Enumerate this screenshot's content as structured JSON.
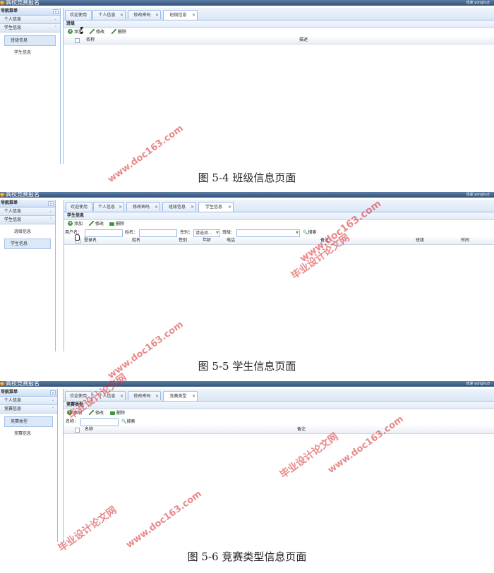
{
  "app": {
    "title": "高校竞赛报名",
    "nav_header": "导航菜单",
    "accordion_personal": "个人信息",
    "accordion_student": "学生信息",
    "accordion_competition": "竞赛信息"
  },
  "shot1": {
    "welcome": "欢迎 yonghu2",
    "nav_items": [
      "班级信息",
      "学生信息"
    ],
    "tabs": [
      "欢迎使用",
      "个人信息",
      "修改密码",
      "班级信息"
    ],
    "panel_title": "班级",
    "toolbar": {
      "add": "添加",
      "edit": "修改",
      "delete": "删除"
    },
    "columns": [
      "名称",
      "描述"
    ],
    "caption": "图 5-4 班级信息页面"
  },
  "shot2": {
    "welcome": "欢迎 yonghu2",
    "nav_items": [
      "班级信息",
      "学生信息"
    ],
    "tabs": [
      "欢迎使用",
      "个人信息",
      "修改密码",
      "班级信息",
      "学生信息"
    ],
    "panel_title": "学生信息",
    "toolbar": {
      "add": "添加",
      "edit": "修改",
      "delete": "删除"
    },
    "search": {
      "login_label": "用户名：",
      "name_label": "姓名：",
      "gender_label": "性别：",
      "gender_value": "请选择...",
      "class_label": "班级：",
      "search_button": "搜索"
    },
    "columns": [
      "登录名",
      "姓名",
      "性别",
      "年龄",
      "电话",
      "备注",
      "班级",
      "时间"
    ],
    "caption": "图 5-5 学生信息页面"
  },
  "shot3": {
    "welcome": "欢迎 yonghu3",
    "nav_items": [
      "竞赛类型",
      "竞赛信息"
    ],
    "tabs": [
      "欢迎使用",
      "个人信息",
      "修改密码",
      "竞赛类型"
    ],
    "panel_title": "竞赛类型",
    "toolbar": {
      "add": "添加",
      "edit": "修改",
      "delete": "删除"
    },
    "search": {
      "name_label": "名称：",
      "search_button": "搜索"
    },
    "columns": [
      "名称",
      "备注"
    ],
    "caption": "图 5-6 竞赛类型信息页面"
  },
  "watermarks": {
    "cn": "毕业设计论文网",
    "url": "www.doc163.com"
  },
  "colors": {
    "titlebar": "#3d6189",
    "border": "#99bbe8",
    "watermark": "#d72828",
    "icon_green": "#3a9a3a"
  }
}
